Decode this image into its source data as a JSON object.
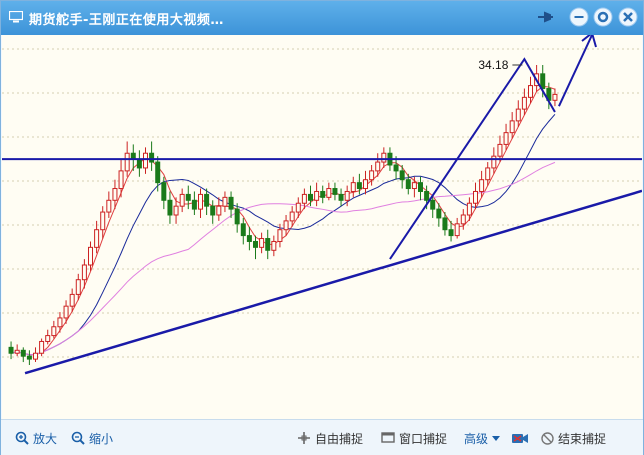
{
  "window": {
    "title": "期货舵手-王刚正在使用大视频…",
    "icons": [
      "monitor-icon",
      "pin-icon",
      "minimize-icon",
      "restore-icon",
      "close-icon"
    ]
  },
  "chart_data": {
    "type": "candlestick",
    "annotation": "34.18",
    "candles": [
      [
        10,
        8,
        12,
        6
      ],
      [
        8,
        9,
        11,
        7
      ],
      [
        9,
        7,
        10,
        5
      ],
      [
        7,
        6,
        9,
        4
      ],
      [
        6,
        8,
        10,
        5
      ],
      [
        8,
        12,
        13,
        7
      ],
      [
        12,
        14,
        16,
        11
      ],
      [
        14,
        17,
        19,
        13
      ],
      [
        17,
        20,
        22,
        15
      ],
      [
        20,
        24,
        26,
        18
      ],
      [
        24,
        28,
        30,
        22
      ],
      [
        28,
        33,
        35,
        26
      ],
      [
        33,
        38,
        40,
        30
      ],
      [
        38,
        44,
        46,
        36
      ],
      [
        44,
        50,
        53,
        42
      ],
      [
        50,
        56,
        58,
        47
      ],
      [
        56,
        60,
        63,
        54
      ],
      [
        60,
        64,
        67,
        57
      ],
      [
        64,
        70,
        74,
        61
      ],
      [
        70,
        76,
        80,
        68
      ],
      [
        76,
        74,
        79,
        70
      ],
      [
        74,
        71,
        77,
        68
      ],
      [
        71,
        76,
        78,
        69
      ],
      [
        76,
        73,
        80,
        70
      ],
      [
        73,
        66,
        75,
        63
      ],
      [
        66,
        60,
        68,
        57
      ],
      [
        60,
        55,
        63,
        52
      ],
      [
        55,
        58,
        61,
        52
      ],
      [
        58,
        62,
        64,
        56
      ],
      [
        62,
        60,
        65,
        57
      ],
      [
        60,
        57,
        63,
        55
      ],
      [
        57,
        62,
        64,
        54
      ],
      [
        62,
        58,
        64,
        55
      ],
      [
        58,
        55,
        60,
        52
      ],
      [
        55,
        58,
        61,
        53
      ],
      [
        58,
        61,
        63,
        56
      ],
      [
        61,
        57,
        63,
        54
      ],
      [
        57,
        52,
        59,
        49
      ],
      [
        52,
        48,
        54,
        45
      ],
      [
        48,
        46,
        51,
        43
      ],
      [
        46,
        44,
        48,
        40
      ],
      [
        44,
        47,
        49,
        42
      ],
      [
        47,
        43,
        50,
        40
      ],
      [
        43,
        46,
        48,
        41
      ],
      [
        46,
        50,
        52,
        44
      ],
      [
        50,
        53,
        55,
        48
      ],
      [
        53,
        56,
        58,
        51
      ],
      [
        56,
        59,
        61,
        54
      ],
      [
        59,
        62,
        64,
        57
      ],
      [
        62,
        60,
        65,
        58
      ],
      [
        60,
        63,
        66,
        58
      ],
      [
        63,
        61,
        65,
        59
      ],
      [
        61,
        64,
        66,
        60
      ],
      [
        64,
        62,
        66,
        60
      ],
      [
        62,
        60,
        64,
        58
      ],
      [
        60,
        63,
        65,
        58
      ],
      [
        63,
        66,
        68,
        61
      ],
      [
        66,
        64,
        69,
        62
      ],
      [
        64,
        67,
        70,
        62
      ],
      [
        67,
        70,
        72,
        65
      ],
      [
        70,
        73,
        76,
        68
      ],
      [
        73,
        76,
        78,
        71
      ],
      [
        76,
        72,
        78,
        70
      ],
      [
        72,
        70,
        75,
        67
      ],
      [
        70,
        67,
        72,
        64
      ],
      [
        67,
        64,
        69,
        62
      ],
      [
        64,
        66,
        68,
        61
      ],
      [
        66,
        63,
        68,
        60
      ],
      [
        63,
        60,
        65,
        57
      ],
      [
        60,
        57,
        62,
        54
      ],
      [
        57,
        54,
        59,
        51
      ],
      [
        54,
        50,
        56,
        48
      ],
      [
        50,
        48,
        53,
        46
      ],
      [
        48,
        52,
        54,
        47
      ],
      [
        52,
        55,
        57,
        50
      ],
      [
        55,
        59,
        61,
        53
      ],
      [
        59,
        63,
        66,
        57
      ],
      [
        63,
        67,
        70,
        61
      ],
      [
        67,
        71,
        73,
        65
      ],
      [
        71,
        75,
        78,
        69
      ],
      [
        75,
        79,
        82,
        73
      ],
      [
        79,
        83,
        86,
        77
      ],
      [
        83,
        87,
        90,
        81
      ],
      [
        87,
        91,
        94,
        85
      ],
      [
        91,
        95,
        98,
        89
      ],
      [
        95,
        99,
        102,
        93
      ],
      [
        99,
        103,
        106,
        97
      ],
      [
        103,
        98,
        106,
        95
      ],
      [
        98,
        94,
        100,
        91
      ],
      [
        94,
        96,
        98,
        92
      ]
    ],
    "levels": {
      "resistance": 74,
      "trend_start": [
        0,
        8
      ],
      "trend_end": [
        89,
        70
      ]
    }
  },
  "toolbar": {
    "zoom_in": "放大",
    "zoom_out": "缩小",
    "free_capture": "自由捕捉",
    "window_capture": "窗口捕捉",
    "advanced": "高级",
    "end_capture": "结束捕捉"
  },
  "colors": {
    "titlebar": "#3d93d8",
    "up": "#cc2222",
    "down": "#1a7a1a",
    "annotation_line": "#1a1aa8",
    "ma_short": "#e04040",
    "ma_mid": "#1a2a9a",
    "ma_long": "#e080e0"
  }
}
